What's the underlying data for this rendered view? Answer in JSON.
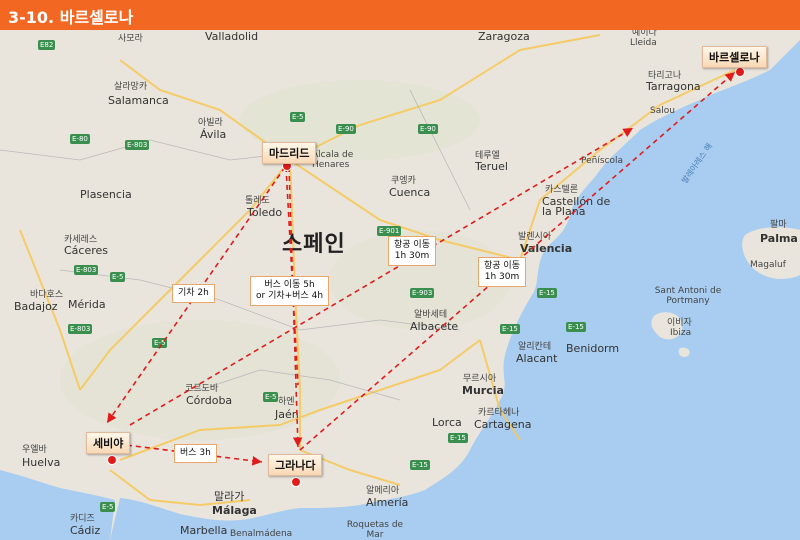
{
  "header": {
    "title": "3-10. 바르셀로나"
  },
  "country_label": "스페인",
  "cities": {
    "madrid": "마드리드",
    "barcelona": "바르셀로나",
    "seville": "세비야",
    "granada": "그라나다"
  },
  "routes": {
    "madrid_seville": "기차 2h",
    "madrid_granada_line1": "버스 이동 5h",
    "madrid_granada_line2": "or 기차+버스 4h",
    "seville_barcelona_line1": "항공 이동",
    "seville_barcelona_line2": "1h 30m",
    "granada_barcelona_line1": "항공 이동",
    "granada_barcelona_line2": "1h 30m",
    "seville_granada": "버스 3h"
  },
  "map_labels": {
    "zaragoza": "Zaragoza",
    "lleida_ko": "예이다",
    "lleida": "Lleida",
    "tarragona_ko": "타리고나",
    "tarragona": "Tarragona",
    "salou": "Salou",
    "valladolid": "Valladolid",
    "samora": "사모라",
    "salamanca_ko": "살라망카",
    "salamanca": "Salamanca",
    "avila_ko": "아빌라",
    "avila": "Ávila",
    "alcala": "Alcala de Henares",
    "teruel_ko": "테루엘",
    "teruel": "Teruel",
    "cuenca_ko": "쿠엥카",
    "cuenca": "Cuenca",
    "toledo_ko": "톨레도",
    "toledo": "Toledo",
    "plasencia": "Plasencia",
    "caceres_ko": "카세레스",
    "caceres": "Cáceres",
    "peniscola": "Peñíscola",
    "castellon_ko": "카스텔론",
    "castellon": "Castellón de la Plana",
    "valencia_ko": "발렌시아",
    "valencia": "Valencia",
    "palma_ko": "팔마",
    "palma": "Palma",
    "magaluf": "Magaluf",
    "badajoz_ko": "바다호스",
    "badajoz": "Badajoz",
    "merida": "Mérida",
    "albacete_ko": "알바세테",
    "albacete": "Albacete",
    "sant_antoni": "Sant Antoni de Portmany",
    "ibiza_ko": "이비자",
    "ibiza": "Ibiza",
    "alicante_ko": "알리칸테",
    "alicante": "Alacant",
    "benidorm": "Benidorm",
    "murcia_ko": "무르시아",
    "murcia": "Murcia",
    "cordoba_ko": "코르도바",
    "cordoba": "Córdoba",
    "jaen_ko": "하엔",
    "jaen": "Jaén",
    "lorca": "Lorca",
    "cartagena_ko": "카르타헤나",
    "cartagena": "Cartagena",
    "huelva_ko": "우엘바",
    "huelva": "Huelva",
    "almeria_ko": "알메리아",
    "almeria": "Almería",
    "malaga_ko": "말라가",
    "malaga": "Málaga",
    "cadiz_ko": "카디즈",
    "cadiz": "Cádiz",
    "marbella": "Marbella",
    "roquetas": "Roquetas de Mar",
    "benalmadena": "Benalmádena",
    "balearic_sea": "발레아레스 해"
  },
  "highways": [
    "E82",
    "E-80",
    "E-803",
    "A-6",
    "E-90",
    "E-5",
    "E-901",
    "E-903",
    "E-15",
    "E-902",
    "E-1",
    "E-803",
    "E-803",
    "E-15",
    "E-15",
    "E-5"
  ]
}
